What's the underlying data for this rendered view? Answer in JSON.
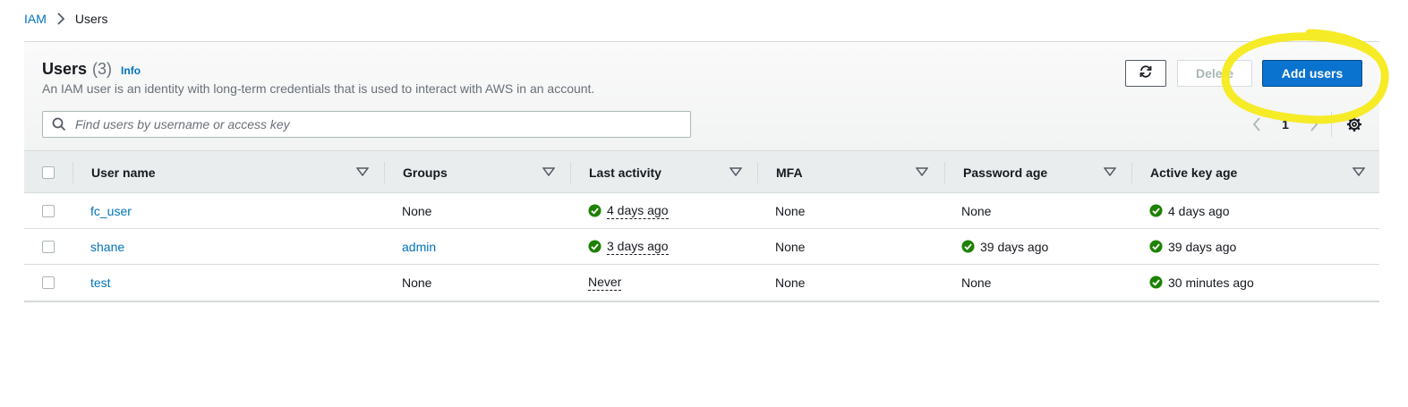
{
  "breadcrumb": {
    "root": "IAM",
    "current": "Users"
  },
  "header": {
    "title": "Users",
    "count": "(3)",
    "info": "Info",
    "description": "An IAM user is an identity with long-term credentials that is used to interact with AWS in an account."
  },
  "search": {
    "placeholder": "Find users by username or access key",
    "value": ""
  },
  "actions": {
    "refresh_icon": "refresh-icon",
    "delete_label": "Delete",
    "add_label": "Add users"
  },
  "pagination": {
    "current_page": "1"
  },
  "colors": {
    "primary": "#0a72cf",
    "link": "#0073bb",
    "success": "#1d8102",
    "highlight": "#f6ea1b"
  },
  "table": {
    "columns": [
      "User name",
      "Groups",
      "Last activity",
      "MFA",
      "Password age",
      "Active key age"
    ],
    "rows": [
      {
        "user_name": "fc_user",
        "groups": "None",
        "last_activity": "4 days ago",
        "mfa": "None",
        "password_age": "None",
        "active_key_age": "4 days ago"
      },
      {
        "user_name": "shane",
        "groups": "admin",
        "last_activity": "3 days ago",
        "mfa": "None",
        "password_age": "39 days ago",
        "active_key_age": "39 days ago"
      },
      {
        "user_name": "test",
        "groups": "None",
        "last_activity": "Never",
        "mfa": "None",
        "password_age": "None",
        "active_key_age": "30 minutes ago"
      }
    ]
  }
}
